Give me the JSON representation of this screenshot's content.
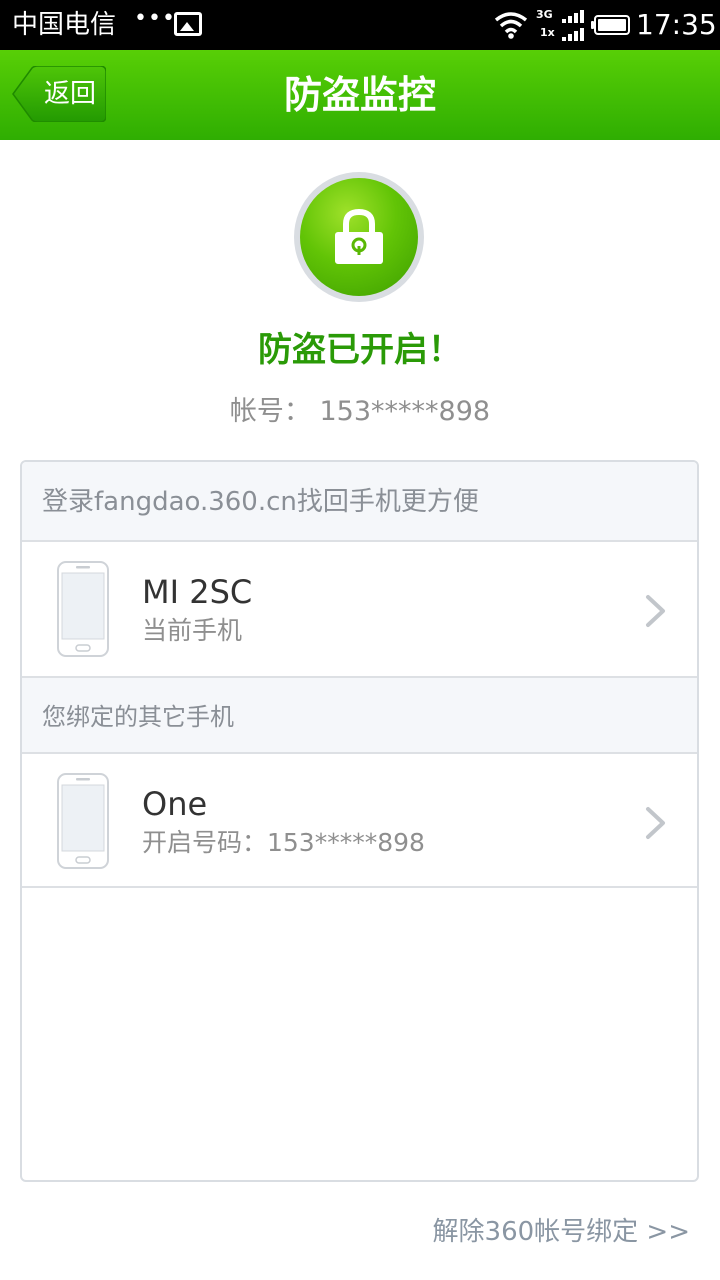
{
  "status_bar": {
    "carrier": "中国电信",
    "dots": "•••",
    "network_3g": "3G",
    "network_1x": "1x",
    "time": "17:35"
  },
  "header": {
    "back_label": "返回",
    "title": "防盗监控"
  },
  "status": {
    "icon": "lock-icon",
    "message": "防盗已开启！",
    "account": "帐号： 153*****898"
  },
  "card": {
    "login_hint": "登录fangdao.360.cn找回手机更方便",
    "current_device": {
      "name": "MI 2SC",
      "subtitle": "当前手机"
    },
    "other_section_title": "您绑定的其它手机",
    "other_devices": [
      {
        "name": "One",
        "subtitle": "开启号码：153*****898"
      }
    ]
  },
  "footer": {
    "unbind_link": "解除360帐号绑定 >>"
  },
  "colors": {
    "header_green": "#3fbd03",
    "status_green": "#2a9a07",
    "link_gray": "#8a96a3"
  }
}
